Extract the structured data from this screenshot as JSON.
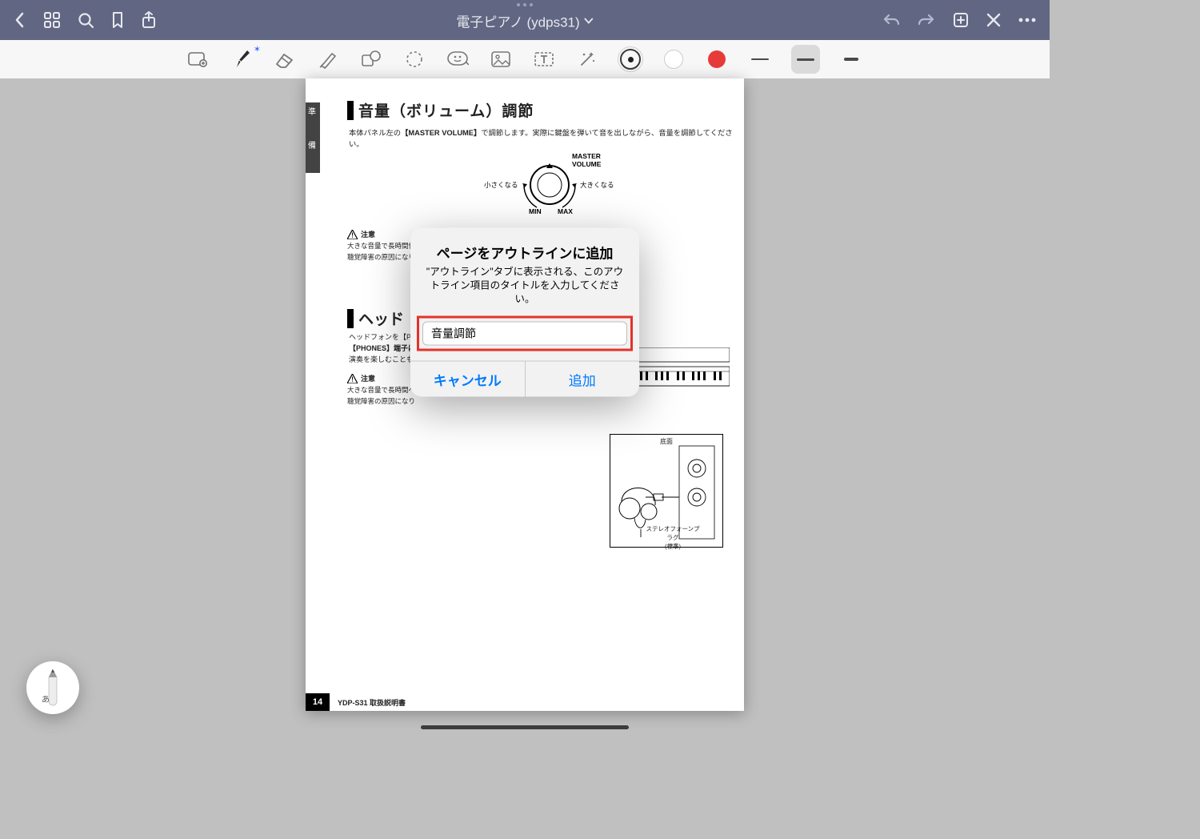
{
  "header": {
    "title": "電子ピアノ (ydps31)"
  },
  "dialog": {
    "title": "ページをアウトラインに追加",
    "body": "\"アウトライン\"タブに表示される、このアウトライン項目のタイトルを入力してください。",
    "input_value": "音量調節",
    "cancel": "キャンセル",
    "confirm": "追加"
  },
  "doc": {
    "side_tab_1": "準",
    "side_tab_2": "備",
    "sec1_title": "音量（ボリューム）調節",
    "sec1_desc_pre": "本体パネル左の",
    "sec1_desc_bold": "【MASTER VOLUME】",
    "sec1_desc_post": "で調節します。実際に鍵盤を弾いて音を出しながら、音量を調節してください。",
    "vol": {
      "title1": "MASTER",
      "title2": "VOLUME",
      "left": "小さくなる",
      "right": "大きくなる",
      "min": "MIN",
      "max": "MAX"
    },
    "caution1_head": "注意",
    "caution1_line1": "大きな音量で長時間使用しないでください。",
    "caution1_line2": "聴覚障害の原因になります。",
    "sec2_title": "ヘッド",
    "sec2_line1_pre": "ヘッドフォンを【P",
    "sec2_line2_pre": "【PHONES】端子は",
    "sec2_line3_pre": "演奏を楽しむことも",
    "caution2_head": "注意",
    "caution2_line1": "大きな音量で長時間ヘ",
    "caution2_line2": "聴覚障害の原因になり",
    "hp_caption_1": "底面",
    "hp_caption_2": "ステレオフォーンプラグ\n(標準)",
    "page_num": "14",
    "model": "YDP-S31  取扱説明書"
  },
  "pencil_char": "あ"
}
